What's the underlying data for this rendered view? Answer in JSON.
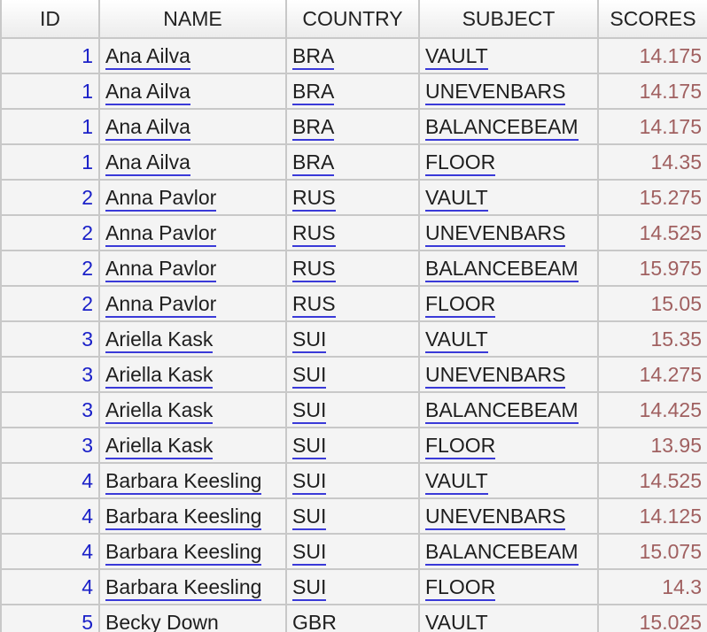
{
  "table": {
    "headers": [
      "ID",
      "NAME",
      "COUNTRY",
      "SUBJECT",
      "SCORES"
    ],
    "rows": [
      {
        "id": "1",
        "name": "Ana Ailva",
        "country": "BRA",
        "subject": "VAULT",
        "score": "14.175"
      },
      {
        "id": "1",
        "name": "Ana Ailva",
        "country": "BRA",
        "subject": "UNEVENBARS",
        "score": "14.175"
      },
      {
        "id": "1",
        "name": "Ana Ailva",
        "country": "BRA",
        "subject": "BALANCEBEAM",
        "score": "14.175"
      },
      {
        "id": "1",
        "name": "Ana Ailva",
        "country": "BRA",
        "subject": "FLOOR",
        "score": "14.35"
      },
      {
        "id": "2",
        "name": "Anna Pavlor",
        "country": "RUS",
        "subject": "VAULT",
        "score": "15.275"
      },
      {
        "id": "2",
        "name": "Anna Pavlor",
        "country": "RUS",
        "subject": "UNEVENBARS",
        "score": "14.525"
      },
      {
        "id": "2",
        "name": "Anna Pavlor",
        "country": "RUS",
        "subject": "BALANCEBEAM",
        "score": "15.975"
      },
      {
        "id": "2",
        "name": "Anna Pavlor",
        "country": "RUS",
        "subject": "FLOOR",
        "score": "15.05"
      },
      {
        "id": "3",
        "name": "Ariella Kask",
        "country": "SUI",
        "subject": "VAULT",
        "score": "15.35"
      },
      {
        "id": "3",
        "name": "Ariella Kask",
        "country": "SUI",
        "subject": "UNEVENBARS",
        "score": "14.275"
      },
      {
        "id": "3",
        "name": "Ariella Kask",
        "country": "SUI",
        "subject": "BALANCEBEAM",
        "score": "14.425"
      },
      {
        "id": "3",
        "name": "Ariella Kask",
        "country": "SUI",
        "subject": "FLOOR",
        "score": "13.95"
      },
      {
        "id": "4",
        "name": "Barbara Keesling",
        "country": "SUI",
        "subject": "VAULT",
        "score": "14.525"
      },
      {
        "id": "4",
        "name": "Barbara Keesling",
        "country": "SUI",
        "subject": "UNEVENBARS",
        "score": "14.125"
      },
      {
        "id": "4",
        "name": "Barbara Keesling",
        "country": "SUI",
        "subject": "BALANCEBEAM",
        "score": "15.075"
      },
      {
        "id": "4",
        "name": "Barbara Keesling",
        "country": "SUI",
        "subject": "FLOOR",
        "score": "14.3"
      },
      {
        "id": "5",
        "name": "Becky Down",
        "country": "GBR",
        "subject": "VAULT",
        "score": "15.025"
      }
    ]
  },
  "colors": {
    "id_text": "#1a20c8",
    "link_underline": "#3a3ad8",
    "score_text": "#a06060",
    "grid_line": "#c8c8c8",
    "cell_bg": "#f4f4f4"
  }
}
